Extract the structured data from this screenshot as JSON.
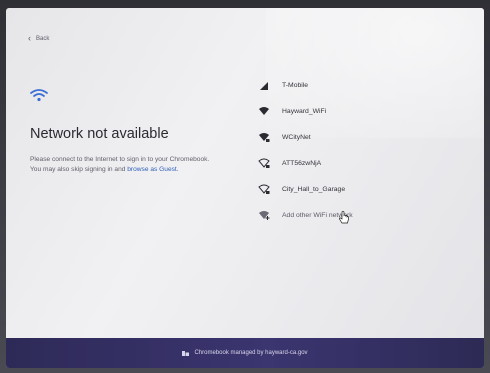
{
  "header": {
    "back_label": "Back"
  },
  "main": {
    "title": "Network not available",
    "description_line1": "Please connect to the Internet to sign in to your Chromebook.",
    "description_line2_prefix": "You may also skip signing in and ",
    "description_guest_link": "browse as Guest."
  },
  "networks": [
    {
      "name": "T-Mobile",
      "icon": "cellular-signal-icon"
    },
    {
      "name": "Hayward_WiFi",
      "icon": "wifi-full-icon"
    },
    {
      "name": "WCityNet",
      "icon": "wifi-secured-icon"
    },
    {
      "name": "ATT56zwNjA",
      "icon": "wifi-weak-secured-icon"
    },
    {
      "name": "City_Hall_to_Garage",
      "icon": "wifi-weak-secured-icon"
    },
    {
      "name": "Add other WiFi network",
      "icon": "wifi-add-icon"
    }
  ],
  "footer": {
    "managed_text": "Chromebook managed by hayward-ca.gov"
  },
  "colors": {
    "link": "#2f5fb8",
    "wifi_accent": "#3b6fd4",
    "footer_bar": "#35306a"
  }
}
